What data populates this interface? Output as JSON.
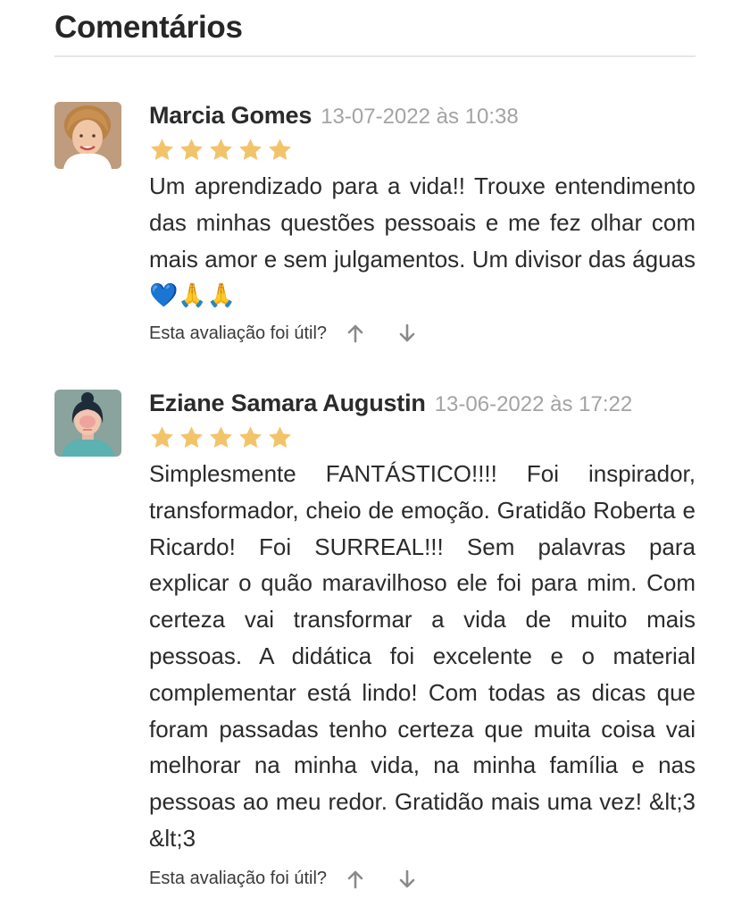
{
  "header": {
    "title": "Comentários"
  },
  "reviews": [
    {
      "author": "Marcia Gomes",
      "date": "13-07-2022 às 10:38",
      "rating": 5,
      "text": "Um aprendizado para a vida!! Trouxe entendimento das minhas questões pessoais e me fez olhar com mais amor e sem julgamentos. Um divisor das águas",
      "emoji": "💙🙏🙏",
      "helpful_label": "Esta avaliação foi útil?"
    },
    {
      "author": "Eziane Samara Augustin",
      "date": "13-06-2022 às 17:22",
      "rating": 5,
      "text": "Simplesmente FANTÁSTICO!!!! Foi inspirador, transformador, cheio de emoção. Gratidão Roberta e Ricardo! Foi SURREAL!!! Sem palavras para explicar o quão maravilhoso ele foi para mim. Com certeza vai transformar a vida de muito mais pessoas. A didática foi excelente e o material complementar está lindo! Com todas as dicas que foram passadas tenho certeza que muita coisa vai melhorar na minha vida, na minha família e nas pessoas ao meu redor. Gratidão mais uma vez! &lt;3 &lt;3",
      "helpful_label": "Esta avaliação foi útil?"
    }
  ],
  "icons": {
    "star": "star-icon",
    "upvote": "arrow-up-icon",
    "downvote": "arrow-down-icon"
  },
  "colors": {
    "star": "#f2c46a",
    "date": "#a3a3a3",
    "divider": "#e6e6e6",
    "arrow": "#8a8a8a"
  }
}
